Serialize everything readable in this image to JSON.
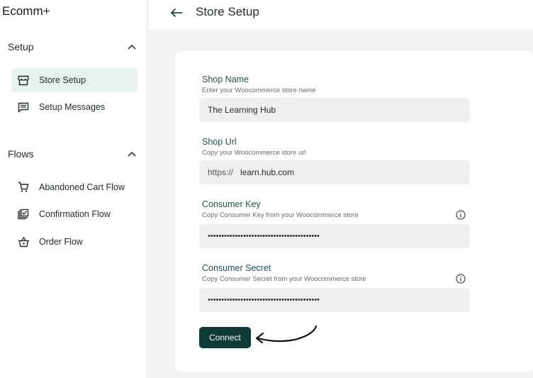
{
  "app": {
    "title": "Ecomm+"
  },
  "sidebar": {
    "sections": [
      {
        "label": "Setup",
        "items": [
          {
            "label": "Store Setup",
            "icon": "store-icon",
            "active": true
          },
          {
            "label": "Setup Messages",
            "icon": "message-icon",
            "active": false
          }
        ]
      },
      {
        "label": "Flows",
        "items": [
          {
            "label": "Abandoned Cart Flow",
            "icon": "cart-icon",
            "active": false
          },
          {
            "label": "Confirmation Flow",
            "icon": "checklist-icon",
            "active": false
          },
          {
            "label": "Order Flow",
            "icon": "basket-icon",
            "active": false
          }
        ]
      }
    ]
  },
  "header": {
    "title": "Store Setup"
  },
  "form": {
    "shop_name": {
      "label": "Shop Name",
      "help": "Enter your Woocommerce store name",
      "value": "The Learning Hub"
    },
    "shop_url": {
      "label": "Shop Url",
      "help": "Copy your Woocommerce store url",
      "prefix": "https://",
      "value": "learn.hub.com"
    },
    "consumer_key": {
      "label": "Consumer Key",
      "help": "Copy Consumer Key from your Woocommerce store",
      "value": "•••••••••••••••••••••••••••••••••••••••••"
    },
    "consumer_secret": {
      "label": "Consumer Secret",
      "help": "Copy Consumer Secret from your Woocommerce store",
      "value": "•••••••••••••••••••••••••••••••••••••••••"
    },
    "connect_label": "Connect"
  },
  "colors": {
    "accent": "#0f3b37",
    "active_bg": "#e7f1ee",
    "field_bg": "#efefef",
    "label": "#255050"
  }
}
